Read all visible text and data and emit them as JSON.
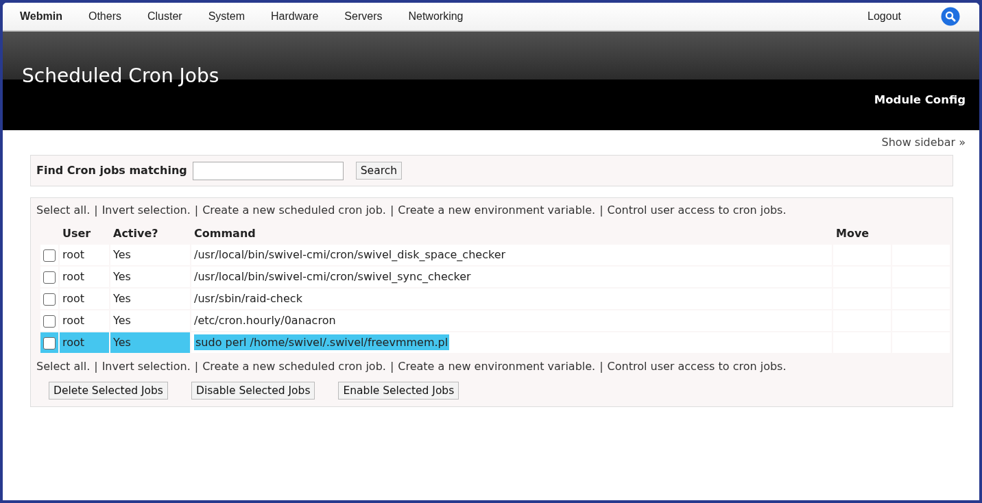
{
  "navbar": {
    "items": [
      {
        "label": "Webmin",
        "selected": true
      },
      {
        "label": "Others",
        "selected": false
      },
      {
        "label": "Cluster",
        "selected": false
      },
      {
        "label": "System",
        "selected": false
      },
      {
        "label": "Hardware",
        "selected": false
      },
      {
        "label": "Servers",
        "selected": false
      },
      {
        "label": "Networking",
        "selected": false
      }
    ],
    "logout": "Logout"
  },
  "header": {
    "title": "Scheduled Cron Jobs",
    "module_config": "Module Config"
  },
  "show_sidebar": "Show sidebar »",
  "search": {
    "label": "Find Cron jobs matching",
    "button": "Search"
  },
  "link_bar_top": {
    "separator": "|",
    "links": [
      "Select all.",
      "Invert selection.",
      "Create a new scheduled cron job.",
      "Create a new environment variable.",
      "Control user access to cron jobs."
    ]
  },
  "table": {
    "columns": [
      "User",
      "Active?",
      "Command",
      "Move"
    ],
    "rows": [
      {
        "checked": false,
        "highlighted": false,
        "user": "root",
        "active": "Yes",
        "command": "/usr/local/bin/swivel-cmi/cron/swivel_disk_space_checker"
      },
      {
        "checked": false,
        "highlighted": false,
        "user": "root",
        "active": "Yes",
        "command": "/usr/local/bin/swivel-cmi/cron/swivel_sync_checker"
      },
      {
        "checked": false,
        "highlighted": false,
        "user": "root",
        "active": "Yes",
        "command": "/usr/sbin/raid-check"
      },
      {
        "checked": false,
        "highlighted": false,
        "user": "root",
        "active": "Yes",
        "command": "/etc/cron.hourly/0anacron"
      },
      {
        "checked": false,
        "highlighted": true,
        "user": "root",
        "active": "Yes",
        "command": "sudo perl /home/swivel/.swivel/freevmmem.pl"
      }
    ]
  },
  "link_bar_bottom": {
    "separator": "|",
    "links": [
      "Select all.",
      "Invert selection.",
      "Create a new scheduled cron job.",
      "Create a new environment variable.",
      "Control user access to cron jobs."
    ]
  },
  "buttons": [
    "Delete Selected Jobs",
    "Disable Selected Jobs",
    "Enable Selected Jobs"
  ]
}
